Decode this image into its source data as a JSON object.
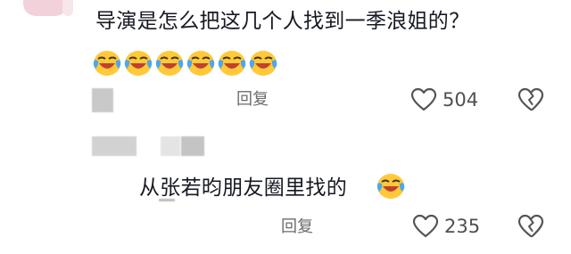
{
  "comment1": {
    "text": "导演是怎么把这几个人找到一季浪姐的？",
    "emojis": [
      "laughing-crying-emoji",
      "laughing-crying-emoji",
      "laughing-crying-emoji",
      "laughing-crying-emoji",
      "laughing-crying-emoji",
      "laughing-crying-emoji"
    ],
    "reply_label": "回复",
    "likes": "504"
  },
  "comment2": {
    "text": "从张若昀朋友圈里找的",
    "emoji": "laughing-crying-emoji",
    "reply_label": "回复",
    "likes": "235"
  },
  "colors": {
    "text": "#161823",
    "muted": "#6b6b6b",
    "emoji_yellow": "#ffc93a",
    "emoji_mouth": "#c2402f",
    "tear": "#4aa8ec"
  }
}
